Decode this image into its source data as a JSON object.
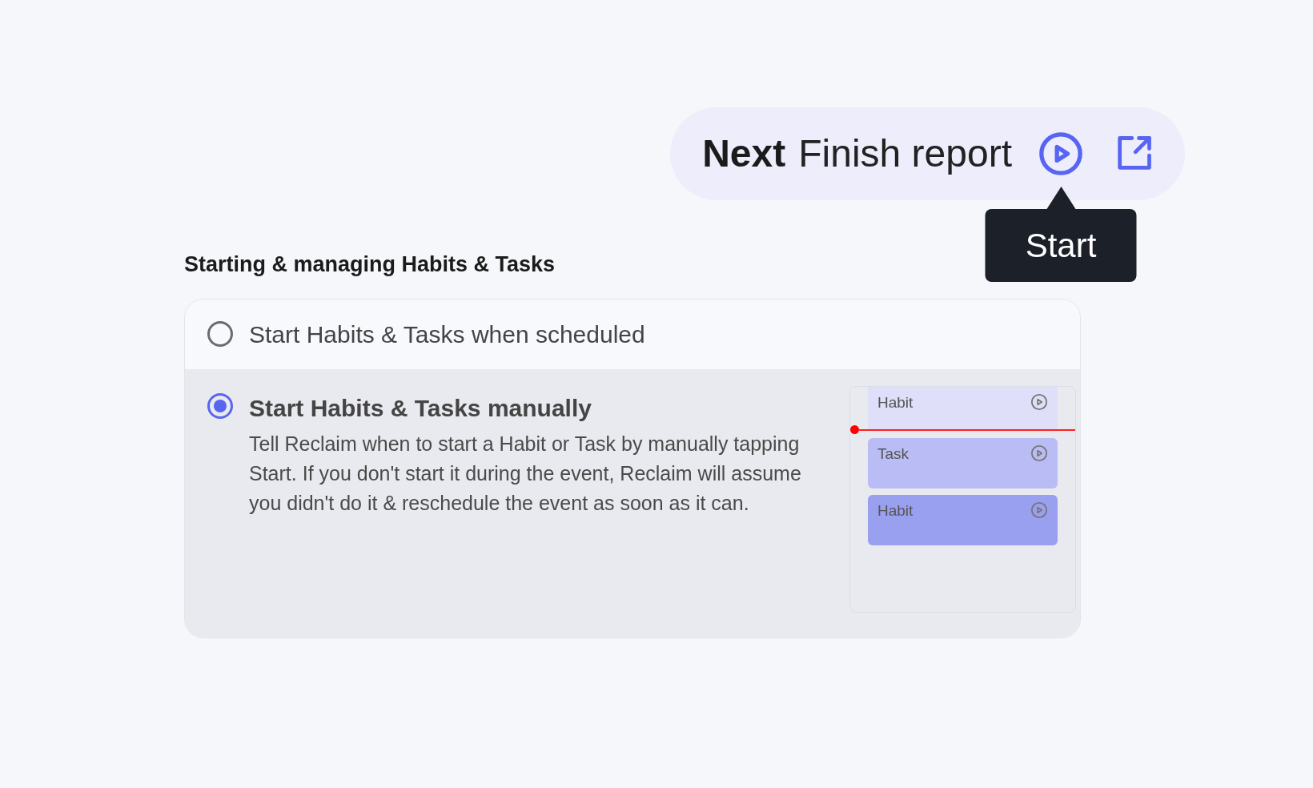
{
  "next_pill": {
    "lead": "Next",
    "title": "Finish report",
    "tooltip": "Start"
  },
  "section": {
    "heading": "Starting & managing Habits & Tasks",
    "options": [
      {
        "label": "Start Habits & Tasks when scheduled",
        "selected": false
      },
      {
        "label": "Start Habits & Tasks manually",
        "selected": true,
        "description": "Tell Reclaim when to start a Habit or Task by manually tapping Start. If you don't start it during the event, Reclaim will assume you didn't do it & reschedule the event as soon as it can."
      }
    ],
    "preview_events": [
      {
        "label": "Habit",
        "color": "#dfdff9"
      },
      {
        "label": "Task",
        "color": "#babdf5"
      },
      {
        "label": "Habit",
        "color": "#9aa0f0"
      }
    ]
  }
}
